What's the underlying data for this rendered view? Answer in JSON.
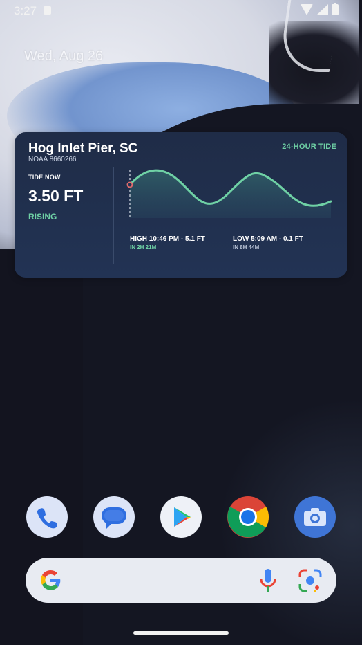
{
  "status_bar": {
    "time": "3:27"
  },
  "home": {
    "date": "Wed, Aug 26"
  },
  "widget": {
    "location": "Hog Inlet Pier, SC",
    "station": "NOAA 8660266",
    "badge": "24-HOUR TIDE",
    "tide_now_label": "TIDE NOW",
    "tide_now_value": "3.50 FT",
    "tide_trend": "RISING",
    "high": {
      "label": "HIGH 10:46 PM  -  5.1 FT",
      "eta": "IN 2H 21M"
    },
    "low": {
      "label": "LOW 5:09 AM  -  0.1 FT",
      "eta": "IN 8H 44M"
    }
  },
  "dock": {
    "apps": [
      "phone-app",
      "messages-app",
      "play-store-app",
      "chrome-app",
      "camera-app"
    ]
  },
  "search_bar": {
    "icons": [
      "google-logo-icon",
      "microphone-icon",
      "lens-icon"
    ]
  },
  "colors": {
    "accent_green": "#6fd1a5",
    "widget_bg": "#1f2c47",
    "marker_red": "#e06b6b"
  }
}
